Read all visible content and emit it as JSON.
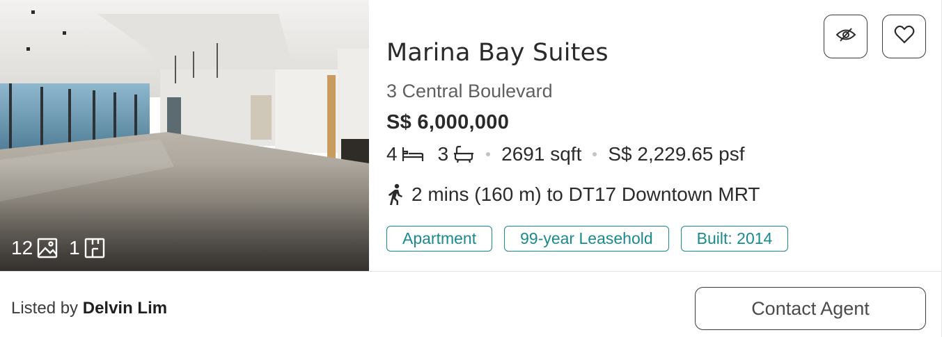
{
  "listing": {
    "title": "Marina Bay Suites",
    "address": "3 Central Boulevard",
    "price": "S$ 6,000,000",
    "bedrooms": "4",
    "bathrooms": "3",
    "area": "2691 sqft",
    "psf": "S$ 2,229.65 psf",
    "walk": "2 mins (160 m) to DT17 Downtown MRT",
    "tags": [
      "Apartment",
      "99-year Leasehold",
      "Built: 2014"
    ]
  },
  "media": {
    "photo_count": "12",
    "floorplan_count": "1"
  },
  "footer": {
    "listed_prefix": "Listed by",
    "agent_name": "Delvin Lim",
    "contact_label": "Contact Agent"
  },
  "icons": {
    "photo": "image-icon",
    "floorplan": "floorplan-icon",
    "bed": "bed-icon",
    "bath": "bathtub-icon",
    "walk": "walking-person-icon",
    "hide": "eye-slash-icon",
    "favorite": "heart-icon"
  },
  "colors": {
    "accent": "#1b8a8c",
    "border": "#3a3a3a",
    "text": "#2b2b2b"
  }
}
